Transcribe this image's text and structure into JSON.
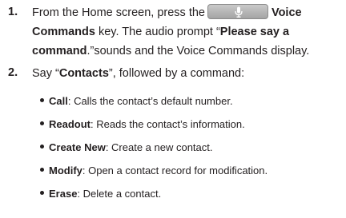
{
  "steps": [
    {
      "number": "1.",
      "line1": {
        "before": "From the Home screen, press the",
        "key_icon": "microphone-icon",
        "bold_after": "Voice"
      },
      "line2": {
        "bold": "Commands",
        "rest": " key. The audio prompt “",
        "bold_quote": "Please say a"
      },
      "line3": {
        "bold": "command",
        "rest": ".”sounds and the Voice Commands display."
      }
    },
    {
      "number": "2.",
      "line1": {
        "before": "Say “",
        "bold": "Contacts",
        "after": "”, followed by a command:"
      }
    }
  ],
  "bullets": [
    {
      "term": "Call",
      "desc": ": Calls the contact’s default number."
    },
    {
      "term": "Readout",
      "desc": ": Reads the contact’s information."
    },
    {
      "term": "Create New",
      "desc": ": Create a new contact."
    },
    {
      "term": "Modify",
      "desc": ": Open a contact record for modification."
    },
    {
      "term": "Erase",
      "desc": ": Delete a contact."
    }
  ],
  "colors": {
    "text": "#231f20",
    "key_button": "#b4b4b4"
  }
}
